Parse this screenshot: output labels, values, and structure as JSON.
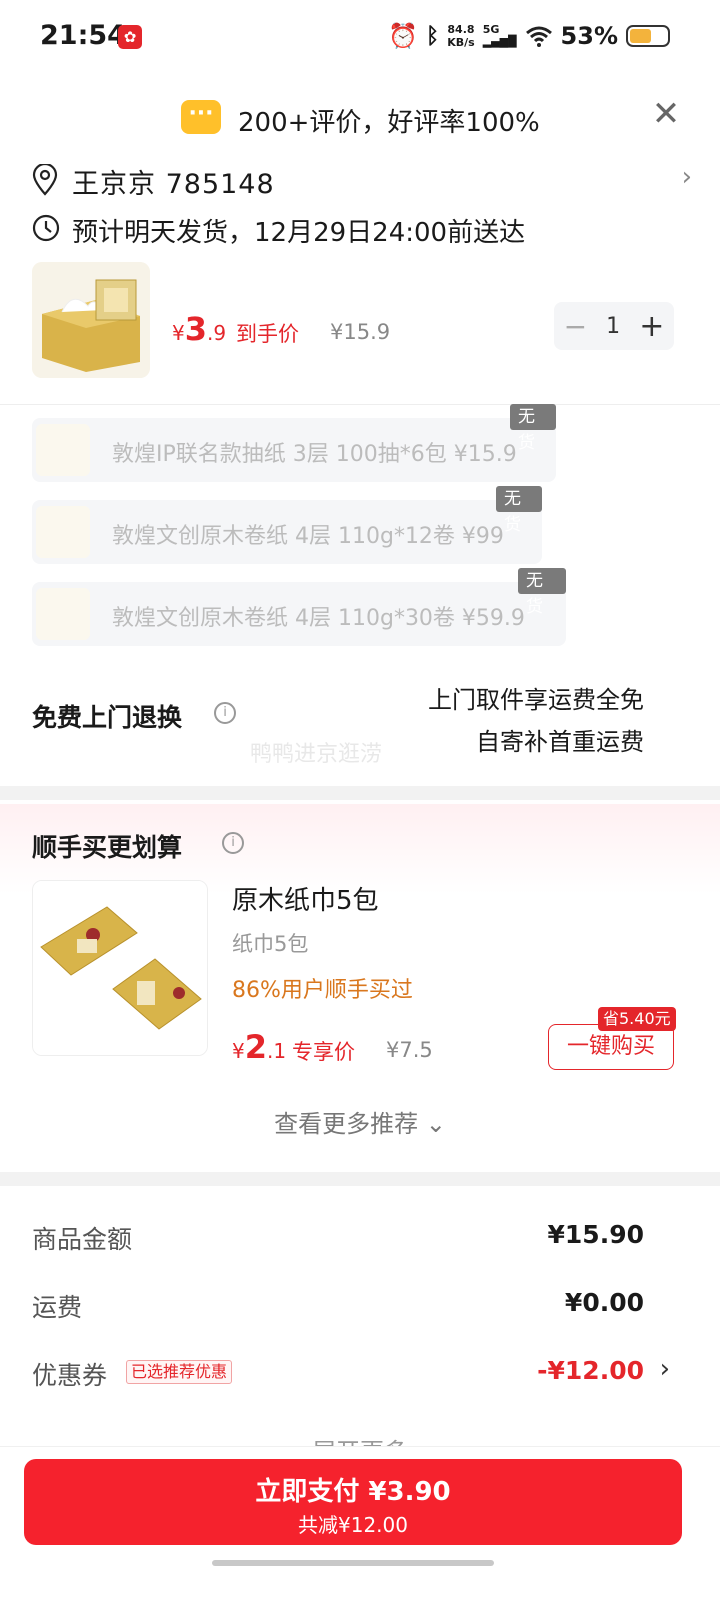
{
  "status_bar": {
    "time": "21:54",
    "net_speed_value": "84.8",
    "net_speed_unit": "KB/s",
    "network": "5G",
    "battery": "53%",
    "battery_level": 0.53
  },
  "review_banner": {
    "text": "200+评价，好评率100%"
  },
  "address": {
    "name_code": "王京京  785148"
  },
  "shipping": {
    "text": "预计明天发货，12月29日24:00前送达"
  },
  "product": {
    "currency": "¥",
    "price_int": "3",
    "price_dec": ".9",
    "price_label": "到手价",
    "original_price": "¥15.9",
    "quantity": "1"
  },
  "options": [
    {
      "text": "敦煌IP联名款抽纸 3层 100抽*6包    ¥15.9",
      "tag": "无货"
    },
    {
      "text": "敦煌文创原木卷纸 4层 110g*12卷    ¥99",
      "tag": "无货"
    },
    {
      "text": "敦煌文创原木卷纸 4层 110g*30卷    ¥59.9",
      "tag": "无货"
    }
  ],
  "returns": {
    "title": "免费上门退换",
    "line1": "上门取件享运费全免",
    "line2": "自寄补首重运费",
    "watermark": "鸭鸭进京逛涝"
  },
  "bundle": {
    "title": "顺手买更划算",
    "item_name": "原木纸巾5包",
    "item_sub": "纸巾5包",
    "item_pct": "86%用户顺手买过",
    "currency": "¥",
    "price_int": "2",
    "price_dec": ".1",
    "price_label": "专享价",
    "original_price": "¥7.5",
    "save_badge": "省5.40元",
    "buy_label": "一键购买",
    "more_label": "查看更多推荐 ⌄"
  },
  "summary": {
    "goods_label": "商品金额",
    "goods_value": "¥15.90",
    "freight_label": "运费",
    "freight_value": "¥0.00",
    "coupon_label": "优惠券",
    "coupon_tag": "已选推荐优惠",
    "coupon_value": "-¥12.00",
    "expand_label": "展开更多"
  },
  "pay": {
    "main_label": "立即支付 ¥3.90",
    "sub_label": "共减¥12.00"
  },
  "colors": {
    "brand_red": "#f5222d",
    "price_red": "#e4262b",
    "accent_orange": "#d9771e",
    "bubble_yellow": "#ffc02a"
  }
}
